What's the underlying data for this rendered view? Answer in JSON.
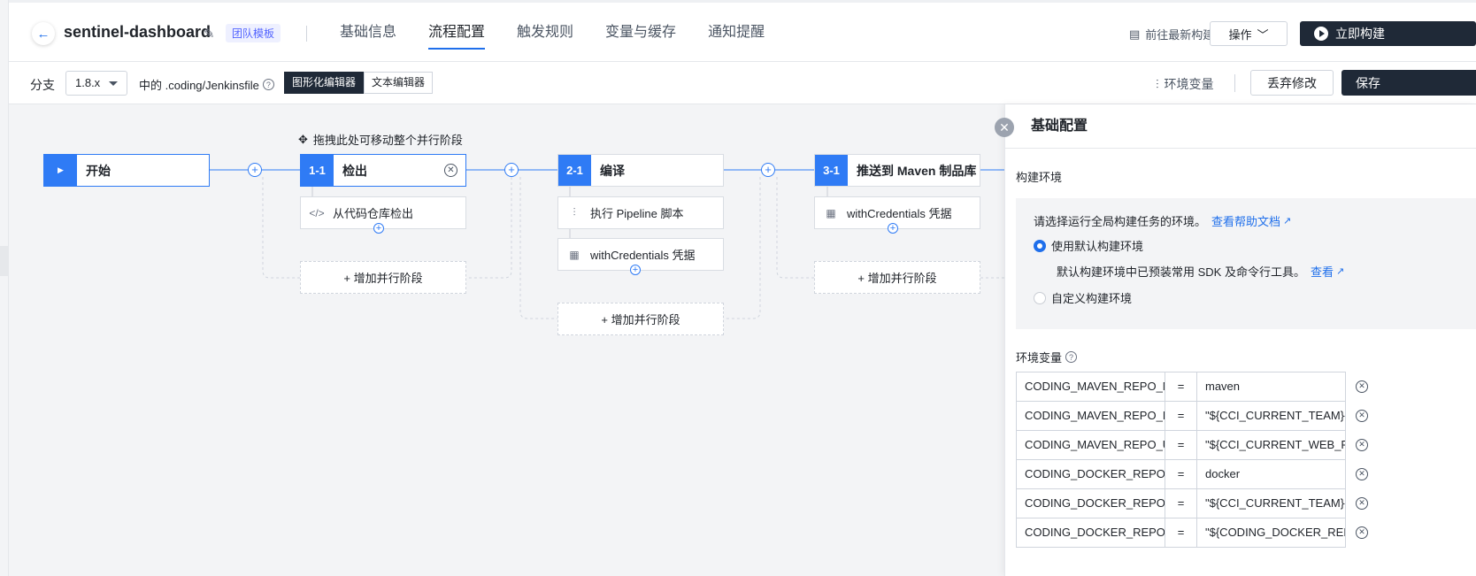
{
  "header": {
    "app_title": "sentinel-dashboard",
    "template_badge": "团队模板",
    "tabs": [
      "基础信息",
      "流程配置",
      "触发规则",
      "变量与缓存",
      "通知提醒"
    ],
    "active_tab": "流程配置",
    "latest_build": "前往最新构建",
    "ops_label": "操作",
    "build_now": "立即构建"
  },
  "toolbar": {
    "branch_label": "分支",
    "branch_value": "1.8.x",
    "file_prefix": "中的 .coding/Jenkinsfile",
    "graph_editor": "图形化编辑器",
    "text_editor": "文本编辑器",
    "env_vars": "环境变量",
    "discard": "丢弃修改",
    "save": "保存"
  },
  "pipeline": {
    "drag_hint": "拖拽此处可移动整个并行阶段",
    "start_label": "开始",
    "stages": [
      {
        "num": "1-1",
        "label": "检出",
        "steps": [
          {
            "icon": "code-icon",
            "label": "从代码仓库检出"
          }
        ]
      },
      {
        "num": "2-1",
        "label": "编译",
        "steps": [
          {
            "icon": "sliders-icon",
            "label": "执行 Pipeline 脚本"
          },
          {
            "icon": "grid-icon",
            "label": "withCredentials 凭据"
          }
        ]
      },
      {
        "num": "3-1",
        "label": "推送到 Maven 制品库",
        "steps": [
          {
            "icon": "grid-icon",
            "label": "withCredentials 凭据"
          }
        ]
      }
    ],
    "add_parallel": "+ 增加并行阶段"
  },
  "panel": {
    "title": "基础配置",
    "build_env_title": "构建环境",
    "intro": "请选择运行全局构建任务的环境。",
    "help_link": "查看帮助文档",
    "opt_default": "使用默认构建环境",
    "default_desc": "默认构建环境中已预装常用 SDK 及命令行工具。",
    "view_link": "查看",
    "opt_custom": "自定义构建环境",
    "env_title": "环境变量",
    "env_rows": [
      {
        "key": "CODING_MAVEN_REPO_NAME",
        "eq": "=",
        "value": "maven"
      },
      {
        "key": "CODING_MAVEN_REPO_ID",
        "eq": "=",
        "value": "\"${CCI_CURRENT_TEAM}-${PROJECT_NAME}-maven\""
      },
      {
        "key": "CODING_MAVEN_REPO_URL",
        "eq": "=",
        "value": "\"${CCI_CURRENT_WEB_PROTOCOL}://...\""
      },
      {
        "key": "CODING_DOCKER_REPO_NAME",
        "eq": "=",
        "value": "docker"
      },
      {
        "key": "CODING_DOCKER_REPO_HOST",
        "eq": "=",
        "value": "\"${CCI_CURRENT_TEAM}-docker.pkg...\""
      },
      {
        "key": "CODING_DOCKER_REPO_URL",
        "eq": "=",
        "value": "\"${CODING_DOCKER_REPO_HOST}/...\""
      }
    ]
  }
}
